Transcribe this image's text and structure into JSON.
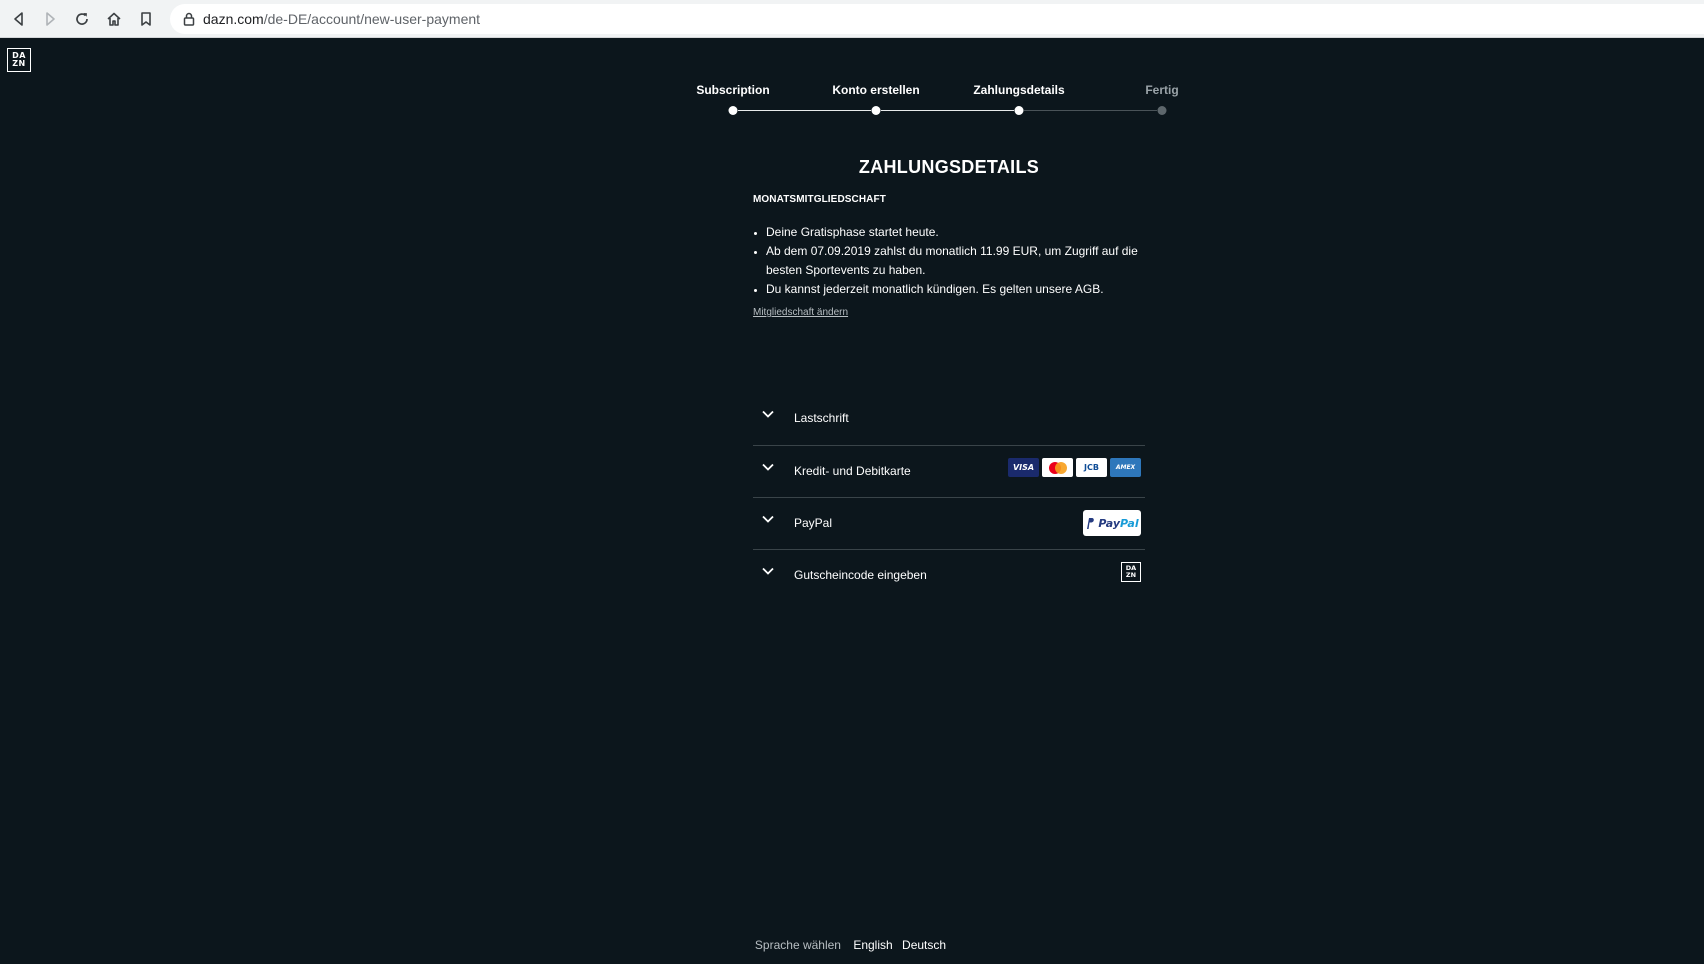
{
  "browser": {
    "url_host": "dazn.com",
    "url_path": "/de-DE/account/new-user-payment",
    "icons": [
      "back-icon",
      "forward-icon",
      "reload-icon",
      "home-icon",
      "bookmark-icon",
      "lock-icon"
    ]
  },
  "header": {
    "logo_line1": "DA",
    "logo_line2": "ZN"
  },
  "stepper": {
    "steps": [
      {
        "label": "Subscription",
        "state": "done"
      },
      {
        "label": "Konto erstellen",
        "state": "done"
      },
      {
        "label": "Zahlungsdetails",
        "state": "current"
      },
      {
        "label": "Fertig",
        "state": "upcoming"
      }
    ]
  },
  "main": {
    "title": "ZAHLUNGSDETAILS",
    "plan_title": "MONATSMITGLIEDSCHAFT",
    "plan_points": [
      "Deine Gratisphase startet heute.",
      "Ab dem 07.09.2019 zahlst du monatlich 11.99 EUR, um Zugriff auf die besten Sportevents zu haben.",
      "Du kannst jederzeit monatlich kündigen. Es gelten unsere AGB."
    ],
    "change_link": "Mitgliedschaft ändern"
  },
  "payment_methods": [
    {
      "label": "Lastschrift",
      "badge": "none"
    },
    {
      "label": "Kredit- und Debitkarte",
      "badge": "cards"
    },
    {
      "label": "PayPal",
      "badge": "paypal"
    },
    {
      "label": "Gutscheincode eingeben",
      "badge": "dazn"
    }
  ],
  "card_logos": {
    "visa": "VISA",
    "jcb": "JCB",
    "amex": "AMEX"
  },
  "paypal_badge": {
    "pay": "Pay",
    "pal": "Pal"
  },
  "footer": {
    "language_label": "Sprache wählen",
    "languages": [
      "English",
      "Deutsch"
    ]
  },
  "colors": {
    "background": "#0c161c",
    "text": "#ffffff",
    "muted": "#b7bec2",
    "divider": "#3a4449"
  }
}
